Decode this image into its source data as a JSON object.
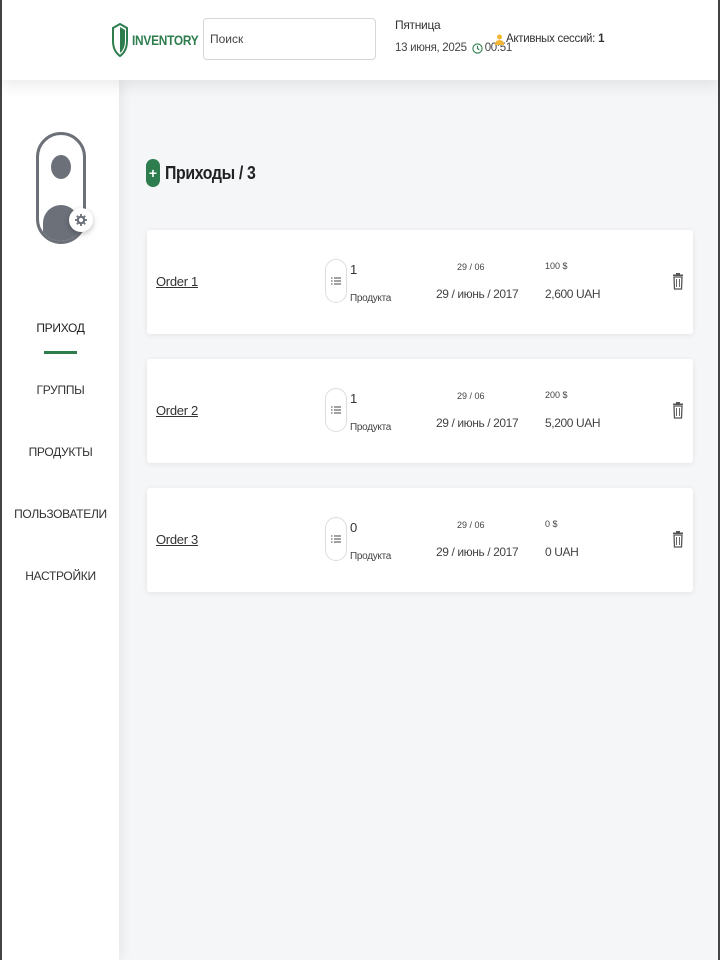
{
  "header": {
    "logo_text": "INVENTORY",
    "search_placeholder": "Поиск",
    "day_name": "Пятница",
    "date": "13 июня, 2025",
    "time": "00:51",
    "sessions_label": "Активных сессий:",
    "sessions_count": "1"
  },
  "sidebar": {
    "items": [
      {
        "label": "ПРИХОД",
        "active": true
      },
      {
        "label": "ГРУППЫ",
        "active": false
      },
      {
        "label": "ПРОДУКТЫ",
        "active": false
      },
      {
        "label": "ПОЛЬЗОВАТЕЛИ",
        "active": false
      },
      {
        "label": "НАСТРОЙКИ",
        "active": false
      }
    ]
  },
  "main": {
    "title": "Приходы / 3",
    "orders": [
      {
        "name": "Order 1",
        "count": "1",
        "count_label": "Продукта",
        "date_short": "29 / 06",
        "date_long": "29 / июнь / 2017",
        "usd": "100 $",
        "uah": "2,600 UAH"
      },
      {
        "name": "Order 2",
        "count": "1",
        "count_label": "Продукта",
        "date_short": "29 / 06",
        "date_long": "29 / июнь / 2017",
        "usd": "200 $",
        "uah": "5,200 UAH"
      },
      {
        "name": "Order 3",
        "count": "0",
        "count_label": "Продукта",
        "date_short": "29 / 06",
        "date_long": "29 / июнь / 2017",
        "usd": "0 $",
        "uah": "0 UAH"
      }
    ]
  },
  "colors": {
    "accent": "#2e7d4f",
    "avatar": "#6b7079",
    "background": "#f5f6f8",
    "session_icon": "#f2b632"
  },
  "icons": {
    "logo": "shield-icon",
    "clock": "clock-icon",
    "sessions": "user-icon",
    "avatar_settings": "gear-icon",
    "add": "plus-icon",
    "products": "list-icon",
    "delete": "trash-icon"
  }
}
